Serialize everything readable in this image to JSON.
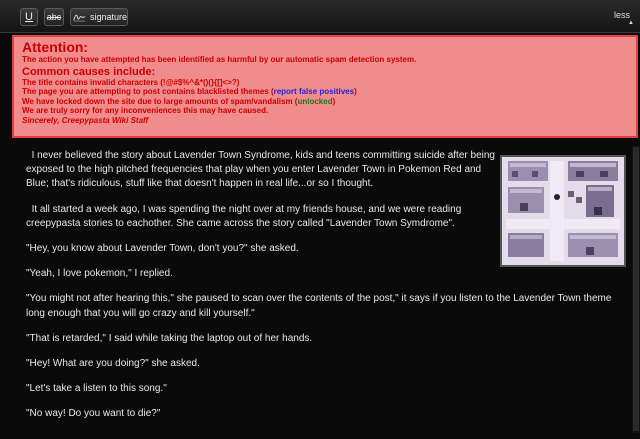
{
  "toolbar": {
    "underline_label": "U",
    "strike_label": "abc",
    "signature_label": "signature",
    "less_label": "less"
  },
  "alert": {
    "title": "Attention:",
    "message": "The action you have attempted has been identified as harmful by our automatic spam detection system.",
    "subtitle": "Common causes include:",
    "cause1": "The title contains invalid characters (!@#$%^&*()(}{[]<>?)",
    "cause2_text": "The page you are attempting to post contains blacklisted themes (",
    "cause2_link": "report false positives",
    "cause2_end": ")",
    "cause3_text": "We have locked down the site due to large amounts of spam/vandalism (",
    "cause3_link": "unlocked",
    "cause3_end": ")",
    "sorry": "We are truly sorry for any inconveniences this may have caused.",
    "signoff": "Sincerely, Creepypasta Wiki Staff"
  },
  "article": {
    "p1": "I never believed the story about Lavender Town Syndrome, kids and teens committing suicide after being exposed to the high pitched frequencies that play when you enter Lavender Town in Pokemon Red and Blue; that's ridiculous, stuff like that doesn't happen in real life...or so I thought.",
    "p2": "It all started a week ago, I was spending the night over at my friends house, and we were reading creepypasta stories to eachother. She came across the story called \"Lavender Town Symdrome\".",
    "p3": "\"Hey, you know about Lavender Town, don't you?\" she asked.",
    "p4": "\"Yeah, I love pokemon,\" I replied.",
    "p5": "\"You might not after hearing this,\" she paused to scan over the contents of the post,\" it says if you listen to the Lavender Town theme long enough that you will go crazy and kill yourself.\"",
    "p6": "\"That is retarded,\" I said while taking the laptop out of her hands.",
    "p7": "\"Hey! What are you doing?\" she asked.",
    "p8": "\"Let's take a listen to this song.\"",
    "p9": "\"No way! Do you want to die?\""
  },
  "colors": {
    "page_bg": "#0a0a0a",
    "alert_bg": "#f08c8c",
    "alert_text": "#cc0000",
    "link_blue": "#2222dd",
    "link_green": "#1a7a1a",
    "article_text": "#e8e8e8"
  }
}
